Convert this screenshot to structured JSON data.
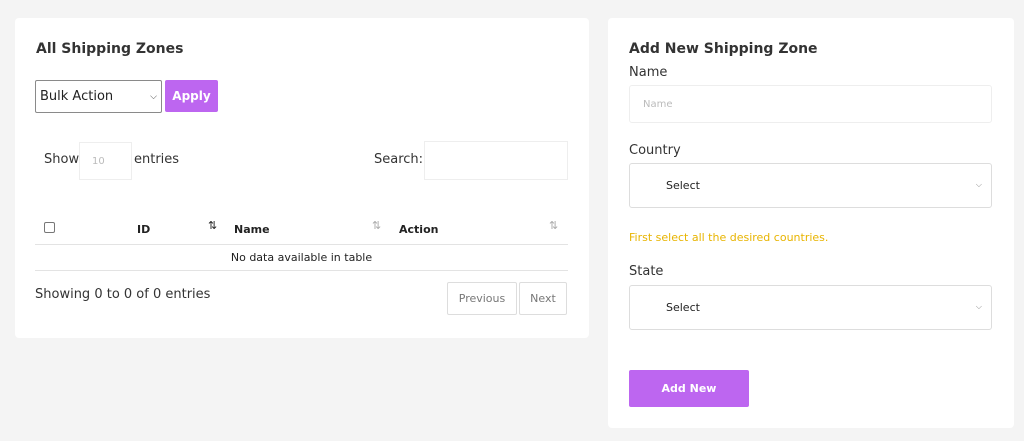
{
  "zones_list": {
    "title": "All Shipping Zones",
    "bulk_action": {
      "selected": "Bulk Action"
    },
    "apply_label": "Apply",
    "show_label": "Show",
    "entries_placeholder": "10",
    "entries_label": "entries",
    "search_label": "Search:",
    "table": {
      "columns": [
        "ID",
        "Name",
        "Action"
      ],
      "empty_message": "No data available in table"
    },
    "showing_text": "Showing 0 to 0 of 0 entries",
    "previous_label": "Previous",
    "next_label": "Next"
  },
  "add_zone": {
    "title": "Add New Shipping Zone",
    "name_label": "Name",
    "name_placeholder": "Name",
    "country_label": "Country",
    "country_select": "Select",
    "hint": "First select all the desired countries.",
    "state_label": "State",
    "state_select": "Select",
    "add_label": "Add New"
  },
  "icons": {
    "sort": "sort-arrows-icon",
    "dropdown": "chevron-down-icon"
  },
  "colors": {
    "accent": "#bd66f0",
    "hint": "#e8b400",
    "background": "#f4f4f4"
  }
}
